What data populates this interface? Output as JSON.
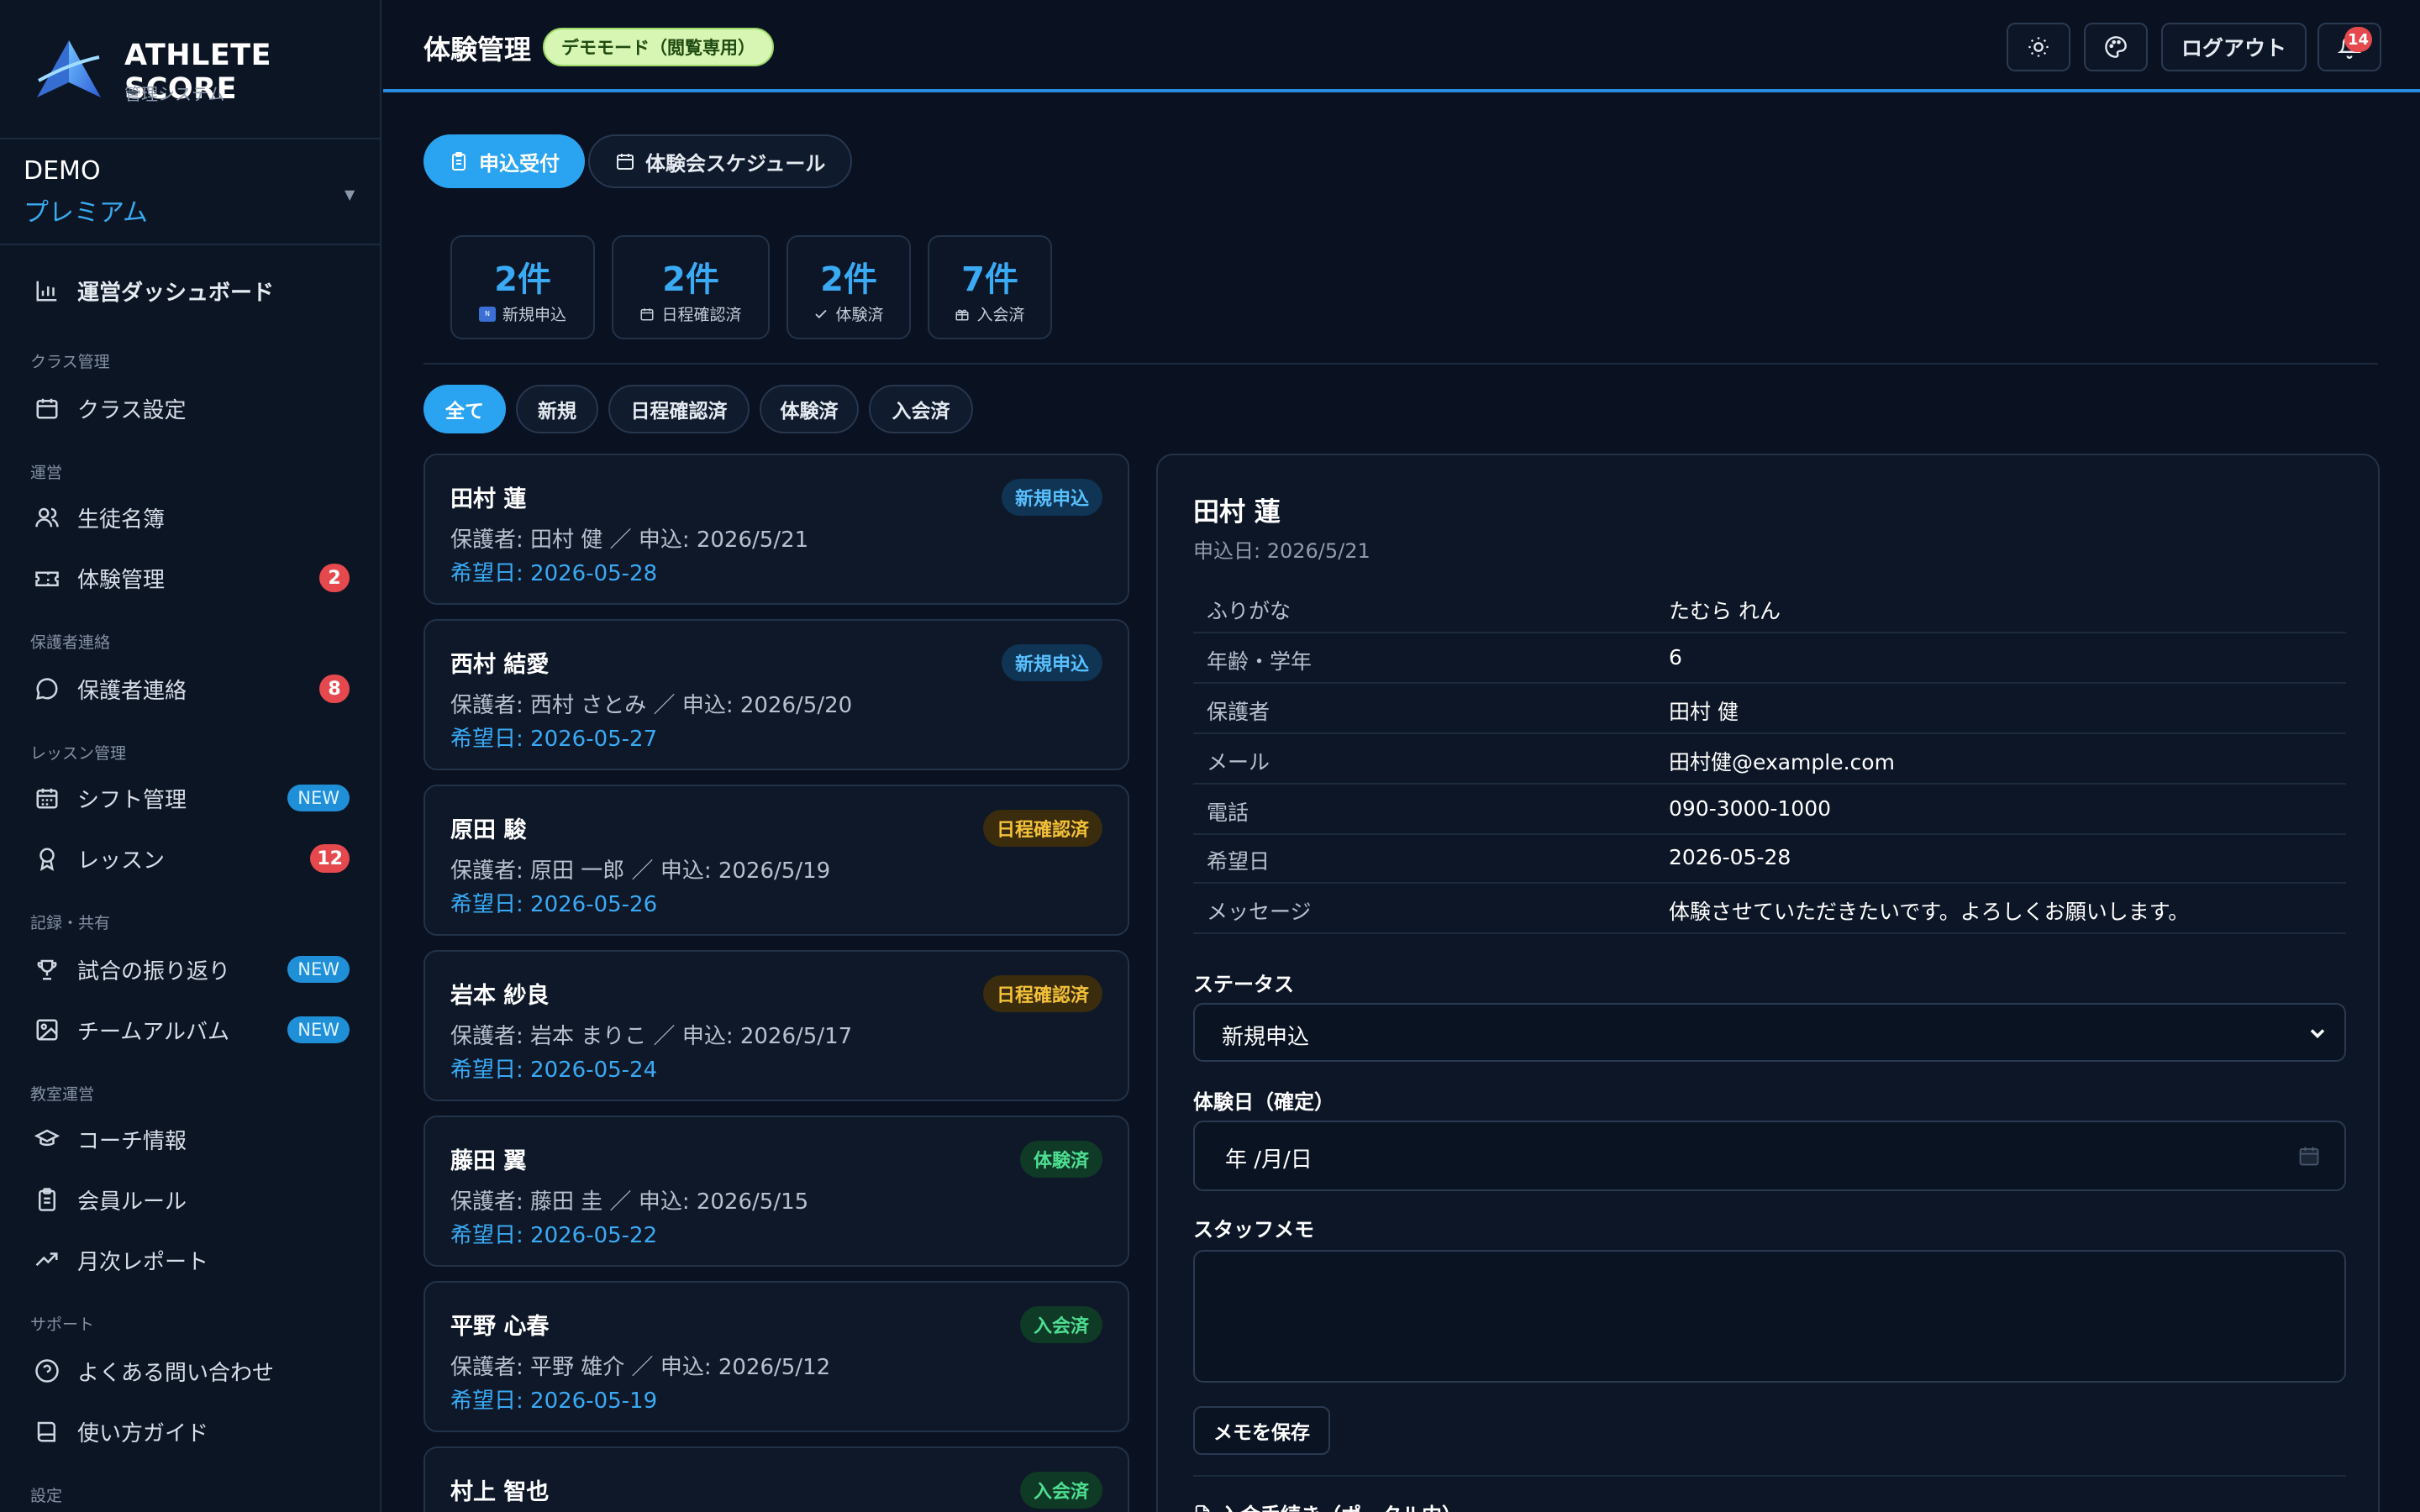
{
  "brand": {
    "name": "ATHLETE SCORE",
    "subtitle": "管理システム"
  },
  "tenant": {
    "name": "DEMO",
    "plan": "プレミアム"
  },
  "nav": {
    "dashboard": "運営ダッシュボード",
    "sections": {
      "class_mgmt": "クラス管理",
      "operations": "運営",
      "guardian": "保護者連絡",
      "lesson_mgmt": "レッスン管理",
      "record_share": "記録・共有",
      "school_ops": "教室運営",
      "support": "サポート",
      "settings": "設定"
    },
    "items": {
      "class_settings": "クラス設定",
      "students": "生徒名簿",
      "trial": "体験管理",
      "trial_badge": "2",
      "guardian_contact": "保護者連絡",
      "guardian_badge": "8",
      "shift": "シフト管理",
      "shift_badge": "NEW",
      "lesson": "レッスン",
      "lesson_badge": "12",
      "match_review": "試合の振り返り",
      "match_badge": "NEW",
      "album": "チームアルバム",
      "album_badge": "NEW",
      "coach": "コーチ情報",
      "rules": "会員ルール",
      "monthly": "月次レポート",
      "faq": "よくある問い合わせ",
      "guide": "使い方ガイド"
    }
  },
  "header": {
    "title": "体験管理",
    "demo": "デモモード（閲覧専用）",
    "logout": "ログアウト",
    "notif_count": "14"
  },
  "tabs": {
    "applications": "申込受付",
    "schedule": "体験会スケジュール"
  },
  "stats": [
    {
      "num": "2件",
      "label": "新規申込"
    },
    {
      "num": "2件",
      "label": "日程確認済"
    },
    {
      "num": "2件",
      "label": "体験済"
    },
    {
      "num": "7件",
      "label": "入会済"
    }
  ],
  "filters": [
    "全て",
    "新規",
    "日程確認済",
    "体験済",
    "入会済"
  ],
  "cards": [
    {
      "name": "田村 蓮",
      "meta": "保護者: 田村 健 ／ 申込: 2026/5/21",
      "date": "希望日: 2026-05-28",
      "status": "新規申込"
    },
    {
      "name": "西村 結愛",
      "meta": "保護者: 西村 さとみ ／ 申込: 2026/5/20",
      "date": "希望日: 2026-05-27",
      "status": "新規申込"
    },
    {
      "name": "原田 駿",
      "meta": "保護者: 原田 一郎 ／ 申込: 2026/5/19",
      "date": "希望日: 2026-05-26",
      "status": "日程確認済"
    },
    {
      "name": "岩本 紗良",
      "meta": "保護者: 岩本 まりこ ／ 申込: 2026/5/17",
      "date": "希望日: 2026-05-24",
      "status": "日程確認済"
    },
    {
      "name": "藤田 翼",
      "meta": "保護者: 藤田 圭 ／ 申込: 2026/5/15",
      "date": "希望日: 2026-05-22",
      "status": "体験済"
    },
    {
      "name": "平野 心春",
      "meta": "保護者: 平野 雄介 ／ 申込: 2026/5/12",
      "date": "希望日: 2026-05-19",
      "status": "入会済"
    },
    {
      "name": "村上 智也",
      "meta": "",
      "date": "",
      "status": "入会済"
    }
  ],
  "detail": {
    "name": "田村 蓮",
    "applied": "申込日: 2026/5/21",
    "rows": [
      {
        "k": "ふりがな",
        "v": "たむら れん"
      },
      {
        "k": "年齢・学年",
        "v": "6"
      },
      {
        "k": "保護者",
        "v": "田村 健"
      },
      {
        "k": "メール",
        "v": "田村健@example.com"
      },
      {
        "k": "電話",
        "v": "090-3000-1000"
      },
      {
        "k": "希望日",
        "v": "2026-05-28"
      },
      {
        "k": "メッセージ",
        "v": "体験させていただきたいです。よろしくお願いします。"
      }
    ],
    "status_label": "ステータス",
    "status_value": "新規申込",
    "trial_date_label": "体験日（確定）",
    "trial_date_placeholder": "年 /月/日",
    "memo_label": "スタッフメモ",
    "memo_value": "",
    "save_memo": "メモを保存",
    "next_section": "入会手続き（ポータル内）"
  },
  "colors": {
    "accent": "#2aa3f0",
    "bg": "#0a1120",
    "danger": "#e5484d"
  }
}
